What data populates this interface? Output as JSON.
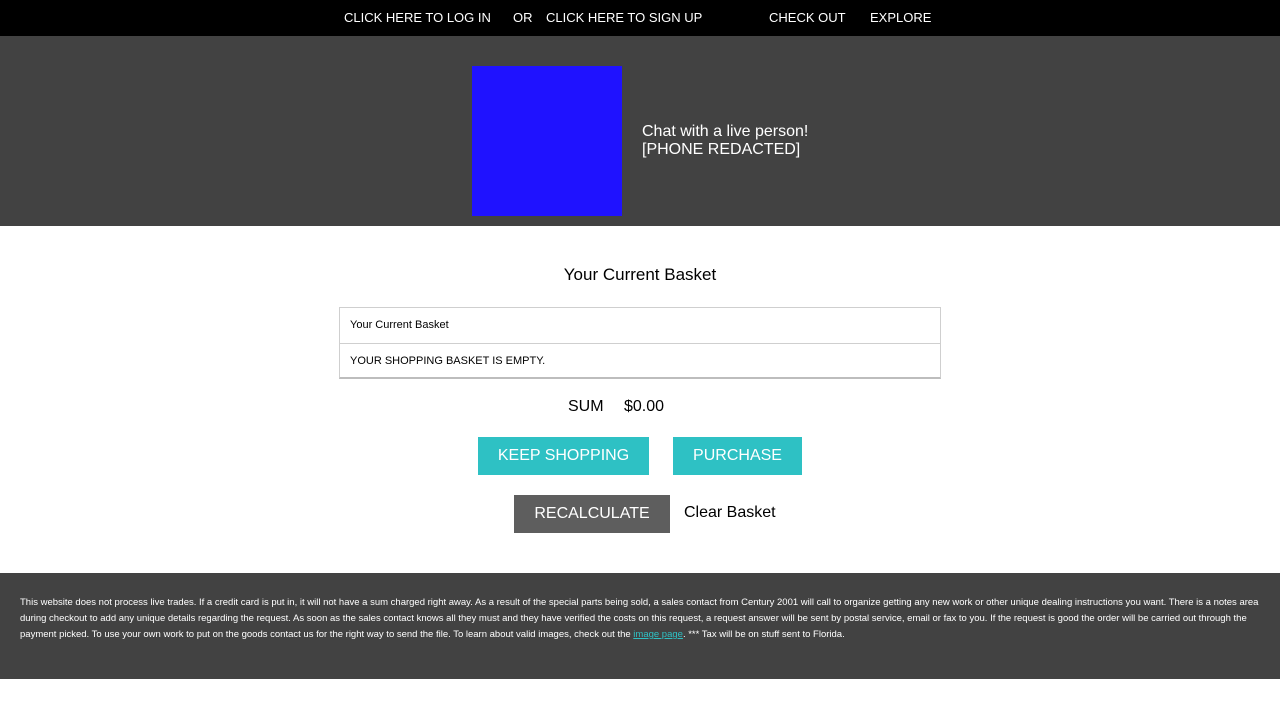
{
  "colors": {
    "topbar_bg": "#000000",
    "hero_bg": "#424242",
    "logo_square": "#1f12ff",
    "accent_button": "#2ec1c4",
    "secondary_button": "#5e5e5e",
    "footer_bg": "#424242",
    "footer_link": "#2ec1c4"
  },
  "topbar": {
    "login": "CLICK HERE TO LOG IN",
    "or": "OR",
    "signup": "CLICK HERE TO SIGN UP",
    "checkout": "CHECK OUT",
    "explore": "EXPLORE"
  },
  "hero": {
    "chat_line1": "Chat with a live person!",
    "chat_line2": "[PHONE REDACTED]"
  },
  "basket": {
    "title": "Your Current Basket",
    "table_header": "Your Current Basket",
    "empty_message": "YOUR SHOPPING BASKET IS EMPTY.",
    "sum_label": "SUM",
    "sum_value": "$0.00",
    "keep_shopping": "KEEP SHOPPING",
    "purchase": "PURCHASE",
    "recalculate": "RECALCULATE",
    "clear": "Clear Basket"
  },
  "footer": {
    "text_before_link": "This website does not process live trades. If a credit card is put in, it will not have a sum charged right away. As a result of the special parts being sold, a sales contact from Century 2001 will call to organize getting any new work or other unique dealing instructions you want. There is a notes area during checkout to add any unique details regarding the request. As soon as the sales contact knows all they must and they have verified the costs on this request, a request answer will be sent by postal service, email or fax to you. If the request is good the order will be carried out through the payment picked. To use your own work to put on the goods contact us for the right way to send the file. To learn about valid images, check out the ",
    "link_text": "image page",
    "text_after_link": ". *** Tax will be on stuff sent to Florida."
  }
}
